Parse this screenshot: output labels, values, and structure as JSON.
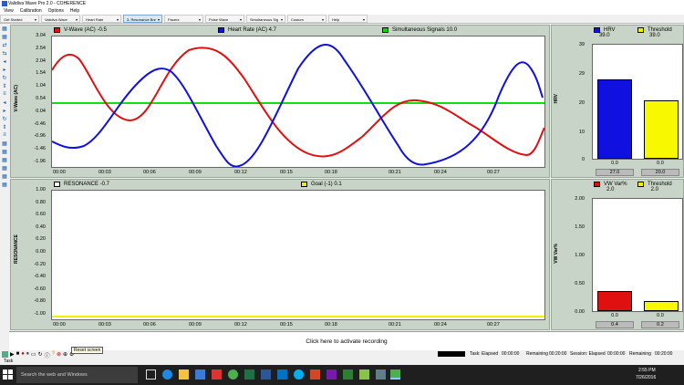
{
  "window": {
    "title": "Validiva Wave Pro 2.0 - COHERENCE"
  },
  "menu": [
    "View",
    "Calibration",
    "Options",
    "Help"
  ],
  "tabs": [
    {
      "label": "Get Started",
      "active": false
    },
    {
      "label": "Validiva Wave",
      "active": false
    },
    {
      "label": "Heart Rate",
      "active": false
    },
    {
      "label": "3. Resonance Bre",
      "active": true
    },
    {
      "label": "Pacers",
      "active": false
    },
    {
      "label": "Pulse Wave",
      "active": false
    },
    {
      "label": "Simultaneous Sig",
      "active": false
    },
    {
      "label": "Custom",
      "active": false
    },
    {
      "label": "Help",
      "active": false
    }
  ],
  "top_chart": {
    "legend": [
      {
        "label": "V-Wave (AC)  -0.5",
        "color": "#e01010"
      },
      {
        "label": "Heart Rate  (AC)  4.7",
        "color": "#1010e0"
      },
      {
        "label": "Simultaneous Signals  10.0",
        "color": "#10d010"
      }
    ],
    "ylabel": "V-Wave (AC)",
    "yticks": [
      "3.04",
      "2.54",
      "2.04",
      "1.54",
      "1.04",
      "0.54",
      "0.04",
      "-0.46",
      "-0.96",
      "-1.46",
      "-1.96"
    ],
    "xticks": [
      "00:00",
      "00:03",
      "00:06",
      "00:09",
      "00:12",
      "00:15",
      "00:18",
      "00:21",
      "00:24",
      "00:27"
    ]
  },
  "bottom_chart": {
    "legend": [
      {
        "label": "RESONANCE  -0.7",
        "color": "#ffffff"
      },
      {
        "label": "Goal  (-1)  0.1",
        "color": "#f0f000"
      }
    ],
    "ylabel": "RESONANCE",
    "yticks": [
      "1.00",
      "0.80",
      "0.60",
      "0.40",
      "0.20",
      "0.00",
      "-0.20",
      "-0.40",
      "-0.60",
      "-0.80",
      "-1.00"
    ],
    "xticks": [
      "00:00",
      "00:03",
      "00:06",
      "00:09",
      "00:12",
      "00:15",
      "00:18",
      "00:21",
      "00:24",
      "00:27"
    ]
  },
  "hrv_panel": {
    "legend": [
      {
        "label": "HRV",
        "value": "39.0",
        "color": "#1010e0"
      },
      {
        "label": "Threshold",
        "value": "39.0",
        "color": "#f0f000"
      }
    ],
    "ylabel": "HRV",
    "yticks": [
      "39",
      "29",
      "20",
      "10",
      "0"
    ],
    "bars": [
      {
        "top": "0.0",
        "bottom": "27.0",
        "value": 27.0,
        "color": "#1010e0"
      },
      {
        "top": "0.0",
        "bottom": "20.0",
        "value": 20.0,
        "color": "#f8f800"
      }
    ],
    "max": 39
  },
  "vw_panel": {
    "legend": [
      {
        "label": "VW Var%",
        "value": "2.0",
        "color": "#e01010"
      },
      {
        "label": "Threshold",
        "value": "2.0",
        "color": "#f0f000"
      }
    ],
    "ylabel": "VW Var%",
    "yticks": [
      "2.00",
      "1.50",
      "1.00",
      "0.50",
      "0.00"
    ],
    "bars": [
      {
        "top": "0.0",
        "bottom": "0.4",
        "value": 0.36,
        "color": "#e01010"
      },
      {
        "top": "0.0",
        "bottom": "0.2",
        "value": 0.18,
        "color": "#f8f800"
      }
    ],
    "max": 2.0
  },
  "record_button": "Click here to activate recording",
  "tooltip": "Reset screen",
  "status": {
    "task_label": "Task",
    "task_elapsed": "Task: Elapsed",
    "task_elapsed_val": "00:00:00",
    "remaining_label": "Remaining",
    "remaining_val": "00:20:00",
    "session_elapsed": "Session: Elapsed",
    "session_elapsed_val": "00:00:00",
    "session_remaining_label": "Remaining",
    "session_remaining_val": "00:20:00"
  },
  "taskbar": {
    "search_placeholder": "Search the web and Windows",
    "time": "2:55 PM",
    "date": "7/26/2016"
  }
}
